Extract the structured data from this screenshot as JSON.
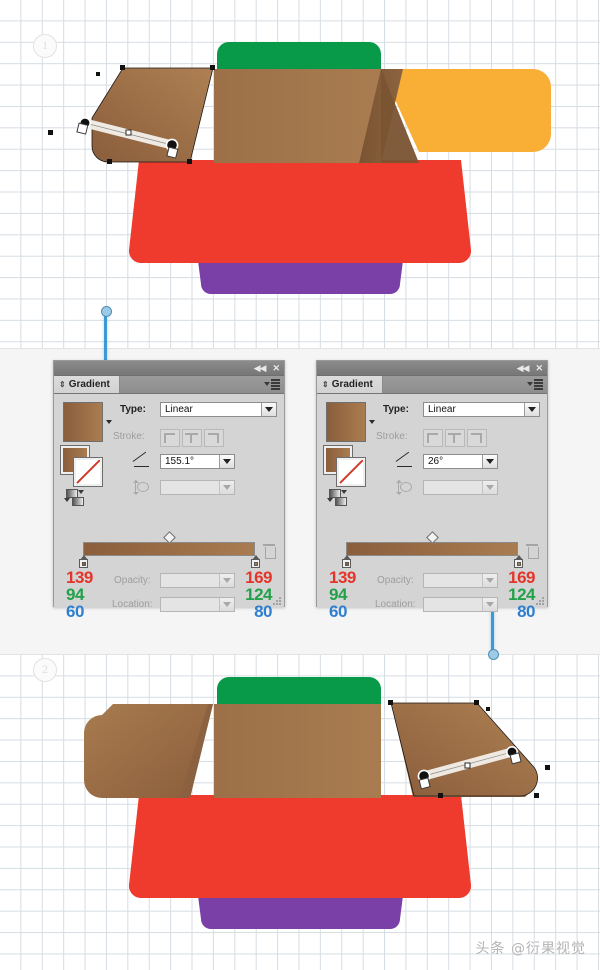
{
  "canvas": {
    "step1_label": "1",
    "step2_label": "2",
    "watermark": "头条 @衍果视觉"
  },
  "colors": {
    "green": "#089949",
    "orange": "#F9AE36",
    "red": "#EE3B2E",
    "purple": "#7B3FA8",
    "brown_light": "#B08457",
    "brown_dark": "#8B5E3C",
    "accent_blue": "#3D98D3",
    "rgb_red": "#E4352A",
    "rgb_green": "#22A14A",
    "rgb_blue": "#2F7FD0"
  },
  "panels": [
    {
      "id": "gradient-panel-left",
      "titlebar": {
        "collapse_icon": "collapse-icon",
        "close_icon": "close-icon"
      },
      "tab_label": "Gradient",
      "menu_icon": "panel-menu-icon",
      "fields": {
        "type_label": "Type:",
        "type_value": "Linear",
        "stroke_label": "Stroke:",
        "angle_value": "155.1°",
        "aspect_value": "",
        "opacity_label": "Opacity:",
        "opacity_value": "",
        "location_label": "Location:",
        "location_value": ""
      },
      "stop_left": {
        "r": "139",
        "g": "94",
        "b": "60"
      },
      "stop_right": {
        "r": "169",
        "g": "124",
        "b": "80"
      },
      "gradient_css": "linear-gradient(to right, #8B5E3C 0%, #A97C50 100%)"
    },
    {
      "id": "gradient-panel-right",
      "titlebar": {
        "collapse_icon": "collapse-icon",
        "close_icon": "close-icon"
      },
      "tab_label": "Gradient",
      "menu_icon": "panel-menu-icon",
      "fields": {
        "type_label": "Type:",
        "type_value": "Linear",
        "stroke_label": "Stroke:",
        "angle_value": "26°",
        "aspect_value": "",
        "opacity_label": "Opacity:",
        "opacity_value": "",
        "location_label": "Location:",
        "location_value": ""
      },
      "stop_left": {
        "r": "139",
        "g": "94",
        "b": "60"
      },
      "stop_right": {
        "r": "169",
        "g": "124",
        "b": "80"
      },
      "gradient_css": "linear-gradient(to right, #8B5E3C 0%, #A97C50 100%)"
    }
  ],
  "illustrations": {
    "top": {
      "name": "box-flaps-gradient-step1",
      "selected_flap": "left-flap",
      "annotator_angle": "155.1"
    },
    "bottom": {
      "name": "box-flaps-gradient-step2",
      "selected_flap": "right-flap",
      "annotator_angle": "26"
    }
  }
}
